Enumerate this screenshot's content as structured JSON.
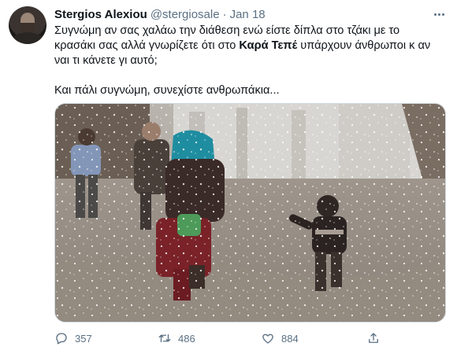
{
  "user": {
    "name": "Stergios Alexiou",
    "handle": "@stergiosale",
    "separator": "·",
    "date": "Jan 18"
  },
  "tweet": {
    "line1": "Συγνώμη αν σας χαλάω την διάθεση ενώ είστε δίπλα στο τζάκι με το",
    "line2_before": "κρασάκι σας αλλά γνωρίζετε ότι στο ",
    "line2_bold": "Καρά Τεπέ",
    "line2_after": " υπάρχουν άνθρωποι κ αν",
    "line3": "ναι τι κάνετε γι αυτό;",
    "line4": "Και πάλι συγνώμη, συνεχίστε ανθρωπάκια..."
  },
  "stats": {
    "replies": "357",
    "retweets": "486",
    "likes": "884"
  },
  "icons": {
    "more": "more-horizontal-icon",
    "reply": "reply-icon",
    "retweet": "retweet-icon",
    "like": "heart-icon",
    "share": "share-icon"
  },
  "colors": {
    "text": "#0f1419",
    "secondary": "#5b7083",
    "border": "#cfd9de"
  }
}
